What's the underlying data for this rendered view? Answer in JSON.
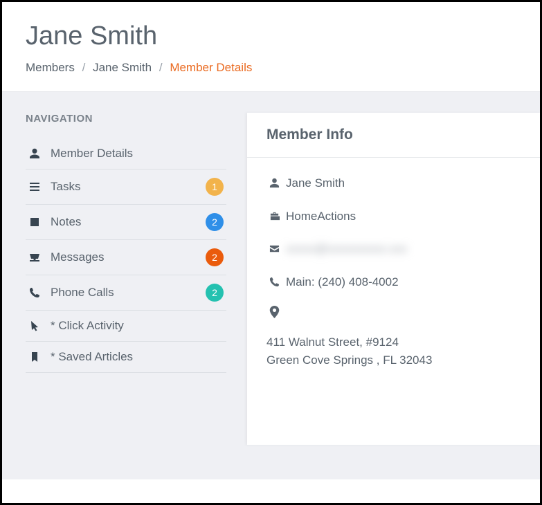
{
  "header": {
    "title": "Jane Smith",
    "breadcrumb": {
      "items": [
        {
          "label": "Members"
        },
        {
          "label": "Jane Smith"
        },
        {
          "label": "Member Details",
          "active": true
        }
      ],
      "sep": "/"
    }
  },
  "sidebar": {
    "title": "NAVIGATION",
    "items": [
      {
        "icon": "user-icon",
        "label": "Member Details"
      },
      {
        "icon": "tasks-icon",
        "label": "Tasks",
        "badge": {
          "text": "1",
          "color": "#f2b34b"
        }
      },
      {
        "icon": "note-icon",
        "label": "Notes",
        "badge": {
          "text": "2",
          "color": "#2f8fe8"
        }
      },
      {
        "icon": "inbox-icon",
        "label": "Messages",
        "badge": {
          "text": "2",
          "color": "#ea5b0c"
        }
      },
      {
        "icon": "phone-icon",
        "label": "Phone Calls",
        "badge": {
          "text": "2",
          "color": "#24c1b0"
        }
      },
      {
        "icon": "cursor-icon",
        "label": "* Click Activity"
      },
      {
        "icon": "bookmark-icon",
        "label": "* Saved Articles"
      }
    ]
  },
  "panel": {
    "title": "Member Info",
    "member": {
      "name": "Jane Smith",
      "company": "HomeActions",
      "email_masked": "xxxxx@xxxxxxxxxx.xxx",
      "phone_label": "Main: (240) 408-4002",
      "address_line1": "411 Walnut Street, #9124",
      "address_line2": "Green Cove Springs ,  FL   32043"
    }
  }
}
